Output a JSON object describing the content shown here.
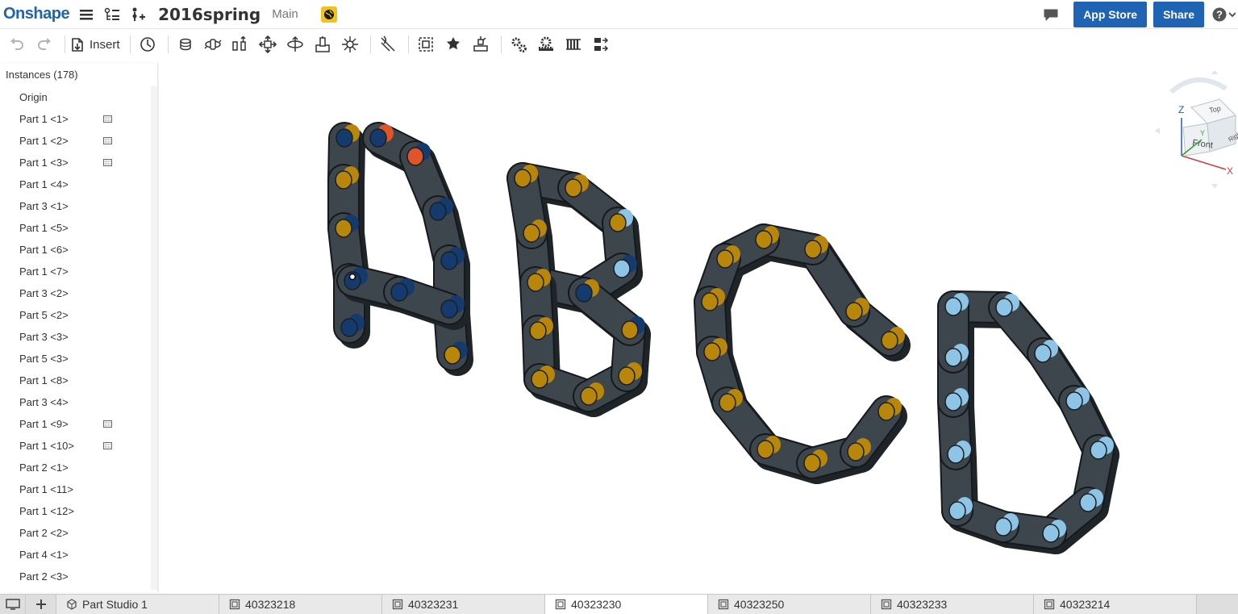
{
  "app": {
    "logo": "Onshape",
    "document_title": "2016spring",
    "branch": "Main"
  },
  "header": {
    "app_store_label": "App Store",
    "share_label": "Share"
  },
  "toolbar": {
    "insert_label": "Insert"
  },
  "instances": {
    "header": "Instances (178)",
    "items": [
      {
        "label": "Origin",
        "flag": false
      },
      {
        "label": "Part 1 <1>",
        "flag": true
      },
      {
        "label": "Part 1 <2>",
        "flag": true
      },
      {
        "label": "Part 1 <3>",
        "flag": true
      },
      {
        "label": "Part 1 <4>",
        "flag": false
      },
      {
        "label": "Part 3 <1>",
        "flag": false
      },
      {
        "label": "Part 1 <5>",
        "flag": false
      },
      {
        "label": "Part 1 <6>",
        "flag": false
      },
      {
        "label": "Part 1 <7>",
        "flag": false
      },
      {
        "label": "Part 3 <2>",
        "flag": false
      },
      {
        "label": "Part 5 <2>",
        "flag": false
      },
      {
        "label": "Part 3 <3>",
        "flag": false
      },
      {
        "label": "Part 5 <3>",
        "flag": false
      },
      {
        "label": "Part 1 <8>",
        "flag": false
      },
      {
        "label": "Part 3 <4>",
        "flag": false
      },
      {
        "label": "Part 1 <9>",
        "flag": true
      },
      {
        "label": "Part 1 <10>",
        "flag": true
      },
      {
        "label": "Part 2 <1>",
        "flag": false
      },
      {
        "label": "Part 1 <11>",
        "flag": false
      },
      {
        "label": "Part 1 <12>",
        "flag": false
      },
      {
        "label": "Part 2 <2>",
        "flag": false
      },
      {
        "label": "Part 4 <1>",
        "flag": false
      },
      {
        "label": "Part 2 <3>",
        "flag": false
      }
    ]
  },
  "viewcube": {
    "top_label": "Top",
    "front_label": "Front",
    "right_label": "Right",
    "axis_x": "X",
    "axis_y": "Y",
    "axis_z": "Z"
  },
  "tabs": [
    {
      "label": "Part Studio 1",
      "active": false,
      "kind": "partstudio"
    },
    {
      "label": "40323218",
      "active": false,
      "kind": "assembly"
    },
    {
      "label": "40323231",
      "active": false,
      "kind": "assembly"
    },
    {
      "label": "40323230",
      "active": true,
      "kind": "assembly"
    },
    {
      "label": "40323250",
      "active": false,
      "kind": "assembly"
    },
    {
      "label": "40323233",
      "active": false,
      "kind": "assembly"
    },
    {
      "label": "40323214",
      "active": false,
      "kind": "assembly"
    }
  ],
  "colors": {
    "brand_blue": "#1f63b5",
    "chain_link": "#3d454d",
    "pin_gold": "#b8860b",
    "pin_light_blue": "#8ec5e6",
    "pin_orange": "#e0542a",
    "pin_navy": "#153a6e"
  },
  "icons": [
    "menu-icon",
    "feature-list-icon",
    "add-branch-icon",
    "public-globe-icon",
    "chat-icon",
    "help-icon",
    "undo-icon",
    "redo-icon",
    "insert-icon",
    "mate-connector-icon",
    "fastened-mate-icon",
    "revolute-mate-icon",
    "slider-mate-icon",
    "planar-mate-icon",
    "cylindrical-mate-icon",
    "pin-slot-mate-icon",
    "ball-mate-icon",
    "tangent-mate-icon",
    "group-icon",
    "replicate-icon",
    "explode-icon",
    "gear-relation-icon",
    "rack-pinion-icon",
    "screw-relation-icon",
    "linear-relation-icon",
    "display-icon",
    "add-tab-icon"
  ]
}
